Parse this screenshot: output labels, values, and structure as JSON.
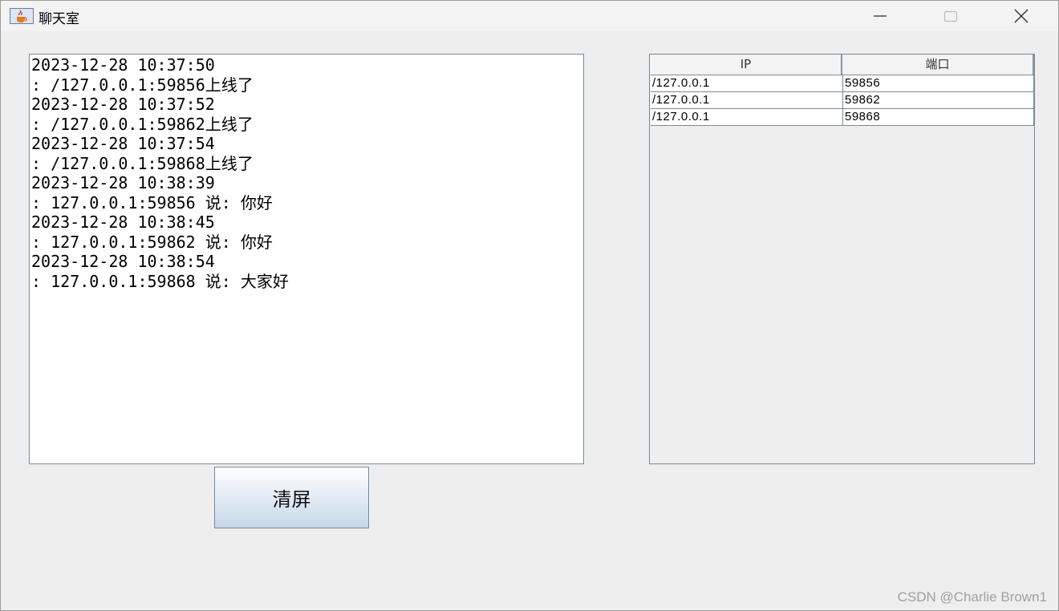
{
  "window": {
    "title": "聊天室",
    "app_icon": "java-cup-icon",
    "controls": [
      "minimize-icon",
      "maximize-icon",
      "close-icon"
    ]
  },
  "chat_log": {
    "lines": [
      "2023-12-28 10:37:50",
      ": /127.0.0.1:59856上线了",
      "2023-12-28 10:37:52",
      ": /127.0.0.1:59862上线了",
      "2023-12-28 10:37:54",
      ": /127.0.0.1:59868上线了",
      "2023-12-28 10:38:39",
      ": 127.0.0.1:59856 说: 你好",
      "2023-12-28 10:38:45",
      ": 127.0.0.1:59862 说: 你好",
      "2023-12-28 10:38:54",
      ": 127.0.0.1:59868 说: 大家好"
    ]
  },
  "clients_table": {
    "headers": [
      "IP",
      "端口"
    ],
    "rows": [
      [
        "/127.0.0.1",
        "59856"
      ],
      [
        "/127.0.0.1",
        "59862"
      ],
      [
        "/127.0.0.1",
        "59868"
      ]
    ]
  },
  "actions": {
    "clear_label": "清屏"
  },
  "watermark": "CSDN @Charlie Brown1"
}
